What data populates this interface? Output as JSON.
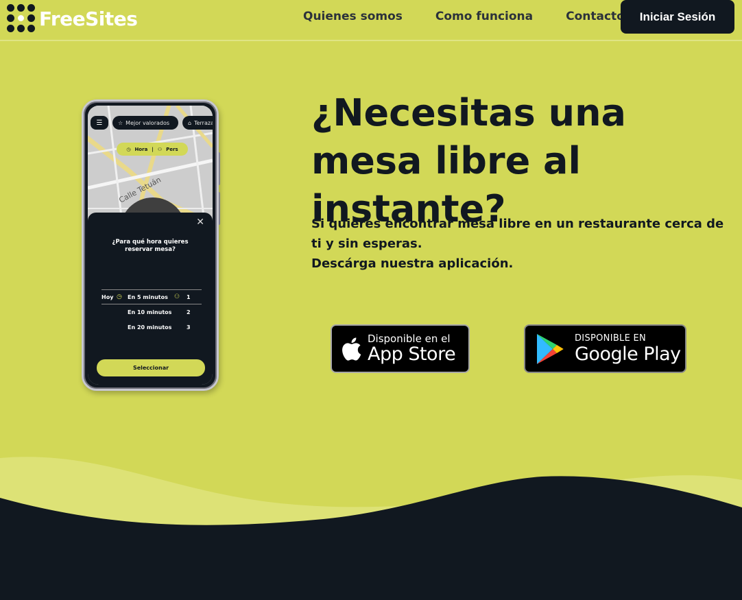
{
  "brand": {
    "name": "FreeSites"
  },
  "nav": {
    "links": [
      "Quienes somos",
      "Como funciona",
      "Contacto"
    ],
    "login_label": "Iniciar Sesión"
  },
  "hero": {
    "title": "¿Necesitas una mesa libre al instante?",
    "description_line1": "Si quieres encontrar mesa libre en un restaurante cerca de ti y sin esperas.",
    "description_line2": "Descárga nuestra aplicación."
  },
  "badges": {
    "apple_small": "Disponible en el",
    "apple_big": "App Store",
    "google_small": "DISPONIBLE EN",
    "google_big": "Google Play"
  },
  "phone": {
    "chips": [
      "Mejor valorados",
      "Terraza"
    ],
    "pill_hora": "Hora",
    "pill_pers": "Pers",
    "street": "Calle Tetuán",
    "question": "¿Para qué hora quieres reservar mesa?",
    "rows": [
      {
        "day": "Hoy",
        "time": "En 5 minutos",
        "people": "1"
      },
      {
        "day": "",
        "time": "En 10 minutos",
        "people": "2"
      },
      {
        "day": "",
        "time": "En 20 minutos",
        "people": "3"
      }
    ],
    "select_label": "Seleccionar"
  },
  "colors": {
    "background": "#d2d857",
    "dark": "#111820",
    "wave_light": "#dde276"
  }
}
